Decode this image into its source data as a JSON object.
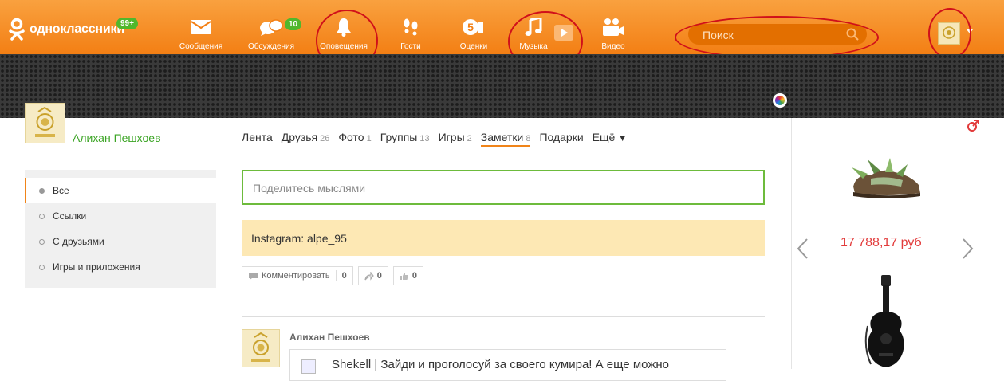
{
  "brand": {
    "logo_text": "одноклассники",
    "badge_count": "99+"
  },
  "nav": [
    {
      "key": "messages",
      "label": "Сообщения",
      "icon": "envelope-icon"
    },
    {
      "key": "discussions",
      "label": "Обсуждения",
      "icon": "chat-bubbles-icon",
      "badge": "10"
    },
    {
      "key": "notifications",
      "label": "Оповещения",
      "icon": "bell-icon"
    },
    {
      "key": "guests",
      "label": "Гости",
      "icon": "footprints-icon"
    },
    {
      "key": "ratings",
      "label": "Оценки",
      "icon": "rating-five-icon"
    },
    {
      "key": "music",
      "label": "Музыка",
      "icon": "music-note-icon"
    },
    {
      "key": "video",
      "label": "Видео",
      "icon": "video-camera-icon"
    }
  ],
  "search": {
    "placeholder": "Поиск"
  },
  "profile": {
    "name": "Алихан Пешхоев"
  },
  "tabs": [
    {
      "label": "Лента",
      "count": ""
    },
    {
      "label": "Друзья",
      "count": "26"
    },
    {
      "label": "Фото",
      "count": "1"
    },
    {
      "label": "Группы",
      "count": "13"
    },
    {
      "label": "Игры",
      "count": "2"
    },
    {
      "label": "Заметки",
      "count": "8",
      "active": true
    },
    {
      "label": "Подарки",
      "count": ""
    },
    {
      "label": "Ещё",
      "count": ""
    }
  ],
  "filters": [
    {
      "label": "Все",
      "active": true
    },
    {
      "label": "Ссылки"
    },
    {
      "label": "С друзьями"
    },
    {
      "label": "Игры и приложения"
    }
  ],
  "composer": {
    "placeholder": "Поделитесь мыслями"
  },
  "note": {
    "text": "Instagram: alpe_95"
  },
  "actions": {
    "comment_label": "Комментировать",
    "comment_count": "0",
    "share_count": "0",
    "like_count": "0"
  },
  "feed": {
    "author": "Алихан Пешхоев",
    "link_text": "Shekell | Зайди и проголосуй за своего кумира! А еще можно"
  },
  "ad": {
    "price": "17 788,17 руб"
  },
  "colors": {
    "brand_orange": "#f37f14",
    "accent_green": "#3ba424",
    "active_orange": "#f08419",
    "price_red": "#e23b3b"
  }
}
